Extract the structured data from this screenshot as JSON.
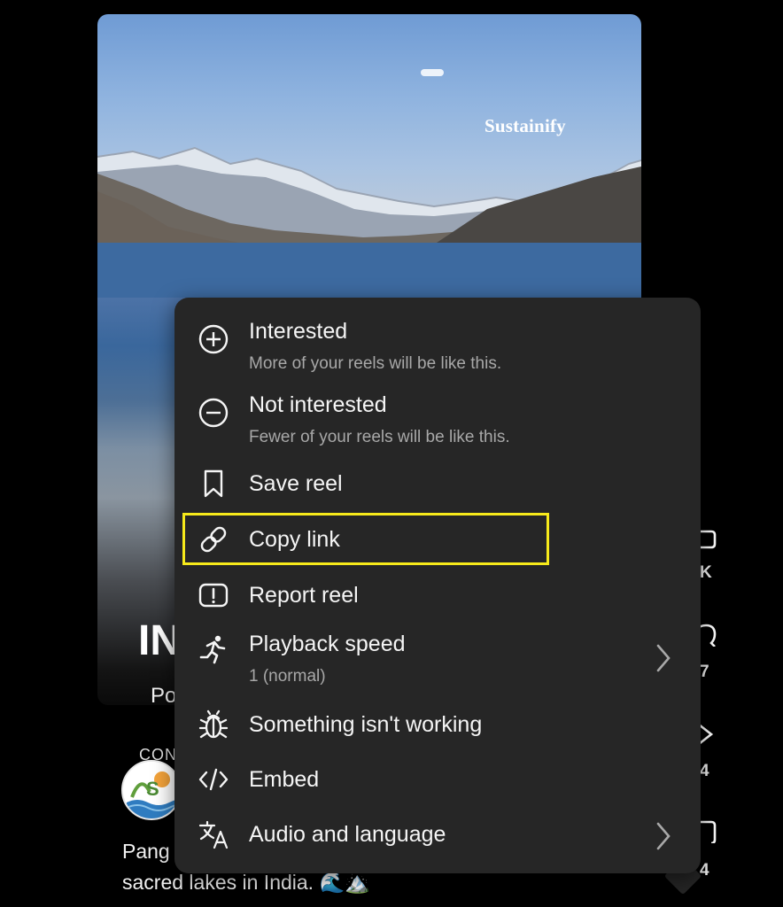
{
  "reel": {
    "brand_watermark": "Sustainify",
    "overlay_title": "IN",
    "overlay_subtitle": "Po"
  },
  "author": {
    "label_partial": "CON",
    "avatar_icon": "sustainify-logo-avatar"
  },
  "caption": {
    "line1": "Pang",
    "line2": "sacred lakes in India. 🌊🏔️"
  },
  "rail": {
    "counts": [
      "K",
      "7",
      "4",
      "4"
    ],
    "icons": [
      "like-icon",
      "comment-icon",
      "share-icon",
      "save-icon"
    ]
  },
  "menu": {
    "items": [
      {
        "id": "interested",
        "label": "Interested",
        "sub": "More of your reels will be like this.",
        "icon": "plus-circle-icon"
      },
      {
        "id": "not-interested",
        "label": "Not interested",
        "sub": "Fewer of your reels will be like this.",
        "icon": "minus-circle-icon"
      },
      {
        "id": "save-reel",
        "label": "Save reel",
        "icon": "bookmark-icon"
      },
      {
        "id": "copy-link",
        "label": "Copy link",
        "icon": "link-icon",
        "highlighted": true
      },
      {
        "id": "report-reel",
        "label": "Report reel",
        "icon": "report-icon"
      },
      {
        "id": "playback-speed",
        "label": "Playback speed",
        "sub": "1 (normal)",
        "icon": "running-person-icon",
        "has_submenu": true
      },
      {
        "id": "something-not-working",
        "label": "Something isn't working",
        "icon": "bug-icon"
      },
      {
        "id": "embed",
        "label": "Embed",
        "icon": "code-icon"
      },
      {
        "id": "audio-language",
        "label": "Audio and language",
        "icon": "translate-icon",
        "has_submenu": true
      }
    ]
  },
  "colors": {
    "menu_bg": "#262626",
    "highlight": "#f7ea1b",
    "sub_text": "#a8a8a8"
  }
}
